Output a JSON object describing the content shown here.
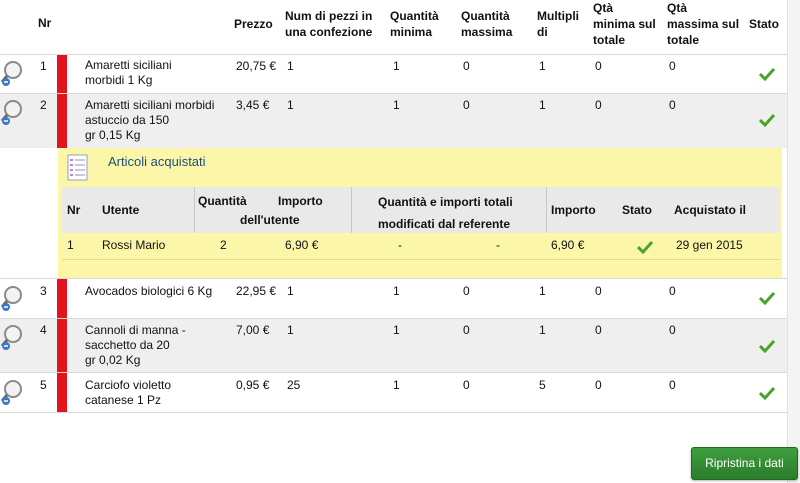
{
  "colors": {
    "accent_red": "#e3141b",
    "yellow_panel": "#fbf6a8",
    "button_green": "#2e8b2e",
    "check_green": "#49a32b"
  },
  "header": {
    "nr": "Nr",
    "prezzo": "Prezzo",
    "num_pezzi": [
      "Num di pezzi in",
      "una confezione"
    ],
    "qta_minima": [
      "Quantità",
      "minima"
    ],
    "qta_massima": [
      "Quantità",
      "massima"
    ],
    "multipli": [
      "Multipli",
      "di"
    ],
    "qta_min_totale": [
      "Qtà",
      "minima sul",
      "totale"
    ],
    "qta_max_totale": [
      "Qtà",
      "massima sul",
      "totale"
    ],
    "stato": "Stato"
  },
  "rows": [
    {
      "nr": "1",
      "name": [
        "Amaretti siciliani",
        "morbidi 1 Kg"
      ],
      "prezzo": "20,75 €",
      "pezzi": "1",
      "min": "1",
      "max": "0",
      "multipli": "1",
      "min_tot": "0",
      "max_tot": "0"
    },
    {
      "nr": "2",
      "name": [
        "Amaretti siciliani morbidi",
        "astuccio da 150",
        "gr 0,15 Kg"
      ],
      "prezzo": "3,45 €",
      "pezzi": "1",
      "min": "1",
      "max": "0",
      "multipli": "1",
      "min_tot": "0",
      "max_tot": "0"
    },
    {
      "nr": "3",
      "name": [
        "Avocados biologici 6 Kg"
      ],
      "prezzo": "22,95 €",
      "pezzi": "1",
      "min": "1",
      "max": "0",
      "multipli": "1",
      "min_tot": "0",
      "max_tot": "0"
    },
    {
      "nr": "4",
      "name": [
        "Cannoli di manna -",
        "sacchetto da 20",
        "gr 0,02 Kg"
      ],
      "prezzo": "7,00 €",
      "pezzi": "1",
      "min": "1",
      "max": "0",
      "multipli": "1",
      "min_tot": "0",
      "max_tot": "0"
    },
    {
      "nr": "5",
      "name": [
        "Carciofo violetto",
        "catanese 1 Pz"
      ],
      "prezzo": "0,95 €",
      "pezzi": "25",
      "min": "1",
      "max": "0",
      "multipli": "5",
      "min_tot": "0",
      "max_tot": "0"
    }
  ],
  "purchased_panel": {
    "title": "Articoli acquistati",
    "icon": "document-list-icon",
    "columns": {
      "nr": "Nr",
      "utente": "Utente",
      "qta_utente": [
        "Quantità",
        "dell'utente"
      ],
      "importo_utente": "Importo",
      "modificati": [
        "Quantità e importi totali",
        "modificati dal referente"
      ],
      "importo": "Importo",
      "stato": "Stato",
      "acquistato": "Acquistato il"
    },
    "rows": [
      {
        "nr": "1",
        "utente": "Rossi Mario",
        "qta": "2",
        "importo_utente": "6,90 €",
        "mod_qta": "-",
        "mod_importo": "-",
        "importo": "6,90 €",
        "acquistato": "29 gen 2015"
      }
    ]
  },
  "button": {
    "label": "Ripristina i dati"
  }
}
